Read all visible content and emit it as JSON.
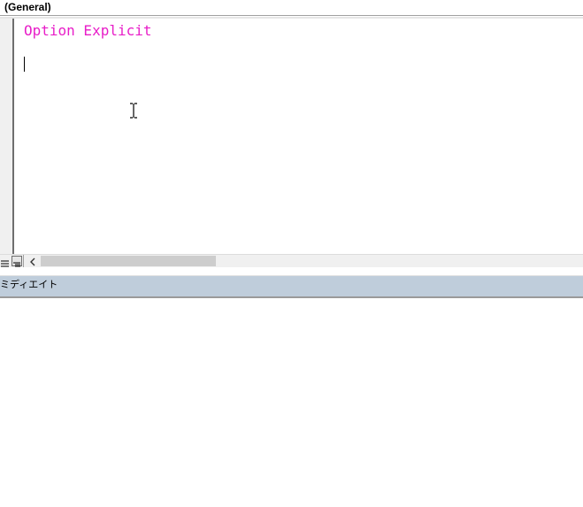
{
  "object_combo": {
    "selected": "(General)"
  },
  "code": {
    "lines": [
      "Option Explicit",
      ""
    ],
    "keyword_color": "#e81ec8",
    "caret_line": 2
  },
  "code_window_footer": {
    "procedure_view_icon": "procedure-view-icon",
    "full_module_view_icon": "full-module-view-icon",
    "scroll_left_icon": "chevron-left-icon"
  },
  "immediate_window": {
    "title": "ミディエイト",
    "title_bar_color": "#bfcddb"
  },
  "cursor": {
    "icon": "text-ibeam-icon"
  }
}
